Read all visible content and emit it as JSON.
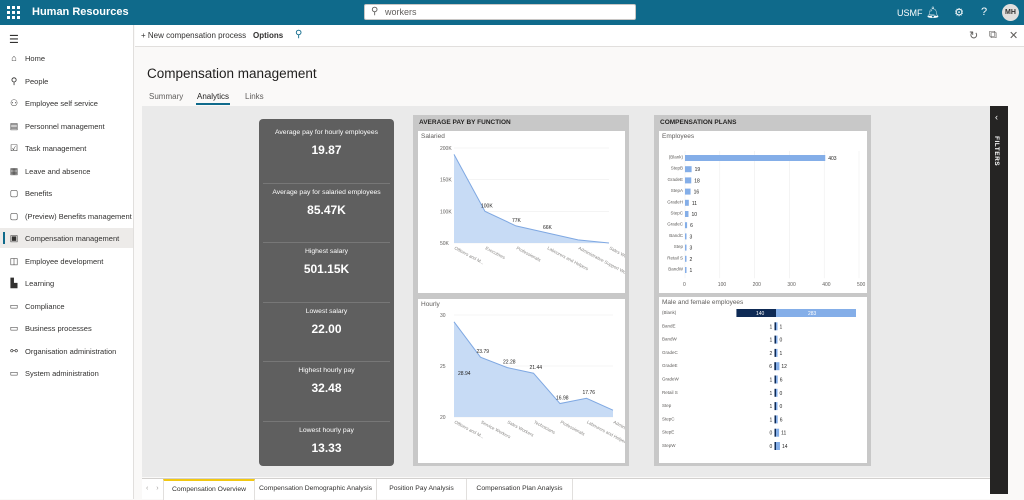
{
  "topbar": {
    "app_title": "Human Resources",
    "search_value": "workers",
    "company": "USMF",
    "avatar_initials": "MH"
  },
  "sidebar": {
    "items": [
      {
        "label": "Home",
        "icon": "home-icon",
        "glyph": "⌂"
      },
      {
        "label": "People",
        "icon": "people-icon",
        "glyph": "⚲"
      },
      {
        "label": "Employee self service",
        "icon": "person-icon",
        "glyph": "⚇"
      },
      {
        "label": "Personnel management",
        "icon": "contact-card-icon",
        "glyph": "▤"
      },
      {
        "label": "Task management",
        "icon": "task-icon",
        "glyph": "☑"
      },
      {
        "label": "Leave and absence",
        "icon": "calendar-icon",
        "glyph": "▦"
      },
      {
        "label": "Benefits",
        "icon": "benefits-icon",
        "glyph": "▢"
      },
      {
        "label": "(Preview) Benefits management",
        "icon": "preview-benefits-icon",
        "glyph": "▢"
      },
      {
        "label": "Compensation management",
        "icon": "compensation-icon",
        "glyph": "▣"
      },
      {
        "label": "Employee development",
        "icon": "development-icon",
        "glyph": "◫"
      },
      {
        "label": "Learning",
        "icon": "learning-icon",
        "glyph": "▙"
      },
      {
        "label": "Compliance",
        "icon": "compliance-icon",
        "glyph": "▭"
      },
      {
        "label": "Business processes",
        "icon": "process-icon",
        "glyph": "▭"
      },
      {
        "label": "Organisation administration",
        "icon": "organization-icon",
        "glyph": "⚯"
      },
      {
        "label": "System administration",
        "icon": "system-admin-icon",
        "glyph": "▭"
      }
    ],
    "active_index": 8
  },
  "actionbar": {
    "new_process": "New compensation process",
    "options": "Options"
  },
  "page": {
    "title": "Compensation management",
    "tabs": [
      "Summary",
      "Analytics",
      "Links"
    ],
    "active_tab": 1
  },
  "kpis": [
    {
      "label": "Average pay for hourly employees",
      "value": "19.87"
    },
    {
      "label": "Average pay for salaried employees",
      "value": "85.47K"
    },
    {
      "label": "Highest salary",
      "value": "501.15K"
    },
    {
      "label": "Lowest salary",
      "value": "22.00"
    },
    {
      "label": "Highest hourly pay",
      "value": "32.48"
    },
    {
      "label": "Lowest hourly pay",
      "value": "13.33"
    }
  ],
  "filters_label": "FILTERS",
  "bottom_tabs": [
    "Compensation Overview",
    "Compensation Demographic Analysis",
    "Position Pay Analysis",
    "Compensation Plan Analysis"
  ],
  "bottom_active": 0,
  "colors": {
    "brand": "#0f6a8b",
    "area": "#c7dbf5",
    "line": "#7fa8e2",
    "bar": "#84aee8",
    "dark_bar": "#0e2a55"
  },
  "chart_data": [
    {
      "type": "area",
      "group_title": "AVERAGE PAY BY FUNCTION",
      "title": "Salaried",
      "categories": [
        "Officers and M...",
        "Executives",
        "Professionals",
        "Labourers and Helpers",
        "Administrative Support Wo...",
        "Sales Workers"
      ],
      "values": [
        190000,
        100000,
        77000,
        66000,
        55000,
        50000
      ],
      "data_labels": [
        "",
        "100K",
        "77K",
        "66K",
        "",
        ""
      ],
      "yticks": [
        "200K",
        "150K",
        "100K",
        "50K"
      ],
      "ylim": [
        50000,
        200000
      ]
    },
    {
      "type": "area",
      "title": "Hourly",
      "categories": [
        "Officers and M...",
        "Service Workers",
        "Sales Workers",
        "Technicians",
        "Professionals",
        "Labourers and Helpers",
        "Administrative Support Wo..."
      ],
      "values": [
        29,
        23.79,
        22.28,
        21.44,
        16.98,
        17.76,
        16
      ],
      "data_labels": [
        "28.94",
        "23.79",
        "22.28",
        "21.44",
        "16.98",
        "17.76",
        ""
      ],
      "yticks": [
        "30",
        "25",
        "20"
      ],
      "ylim": [
        15,
        30
      ]
    },
    {
      "type": "bar",
      "group_title": "COMPENSATION PLANS",
      "title": "Employees",
      "categories": [
        "(Blank)",
        "StepB",
        "GradeE",
        "StepA",
        "GradeH",
        "StepC",
        "GradeC",
        "BandC",
        "Step",
        "Retail S",
        "BandW"
      ],
      "values": [
        403,
        19,
        18,
        16,
        11,
        10,
        6,
        3,
        3,
        2,
        1
      ],
      "xticks": [
        "0",
        "100",
        "200",
        "300",
        "400",
        "500"
      ],
      "xlim": [
        0,
        500
      ]
    },
    {
      "type": "bar",
      "title": "Male and female employees",
      "categories": [
        "(Blank)",
        "BandE",
        "BandW",
        "GradeC",
        "GradeE",
        "GradeW",
        "Retail S",
        "Step",
        "StepC",
        "StepE",
        "StepW"
      ],
      "series": [
        {
          "values": [
            140,
            1,
            1,
            2,
            6,
            1,
            1,
            1,
            1,
            0,
            0
          ]
        },
        {
          "values": [
            283,
            1,
            0,
            1,
            12,
            6,
            0,
            0,
            6,
            11,
            14
          ]
        }
      ]
    }
  ]
}
